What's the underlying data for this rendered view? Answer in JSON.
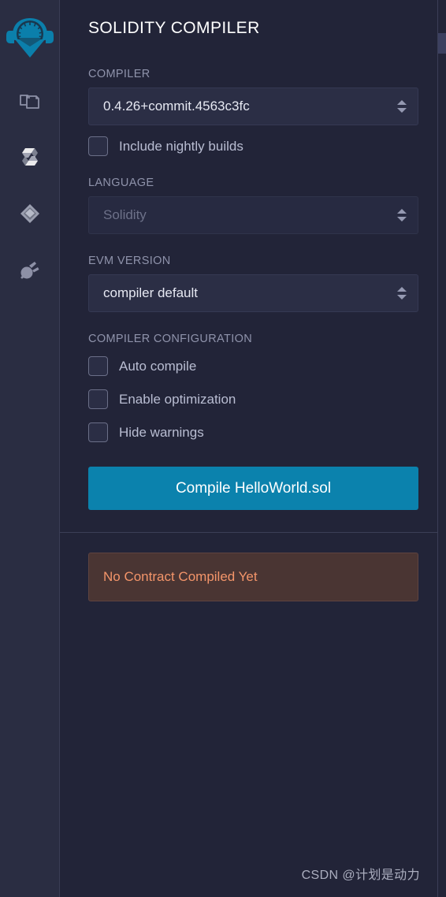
{
  "rail": {
    "logo": {
      "name": "remix-logo",
      "label": "Remix"
    },
    "items": [
      {
        "icon": "file-explorer-icon",
        "label": "File explorers",
        "active": false
      },
      {
        "icon": "solidity-compiler-icon",
        "label": "Solidity compiler",
        "active": true
      },
      {
        "icon": "deploy-run-icon",
        "label": "Deploy & run transactions",
        "active": false
      },
      {
        "icon": "plugin-manager-icon",
        "label": "Plugin manager",
        "active": false
      }
    ]
  },
  "panel": {
    "title": "SOLIDITY COMPILER",
    "compiler": {
      "label": "COMPILER",
      "value": "0.4.26+commit.4563c3fc"
    },
    "nightly": {
      "label": "Include nightly builds",
      "checked": false
    },
    "language": {
      "label": "LANGUAGE",
      "value": "Solidity",
      "disabled": true
    },
    "evm": {
      "label": "EVM VERSION",
      "value": "compiler default"
    },
    "configuration": {
      "label": "COMPILER CONFIGURATION",
      "options": [
        {
          "label": "Auto compile",
          "checked": false
        },
        {
          "label": "Enable optimization",
          "checked": false
        },
        {
          "label": "Hide warnings",
          "checked": false
        }
      ]
    },
    "compile_button": "Compile HelloWorld.sol",
    "alert": {
      "text": "No Contract Compiled Yet"
    }
  },
  "watermark": "CSDN @计划是动力",
  "colors": {
    "panel_bg": "#222438",
    "rail_bg": "#2a2d42",
    "accent": "#0b82ad",
    "alert_bg": "#4a3533",
    "alert_text": "#f4956a",
    "logo": "#0b7fab"
  }
}
